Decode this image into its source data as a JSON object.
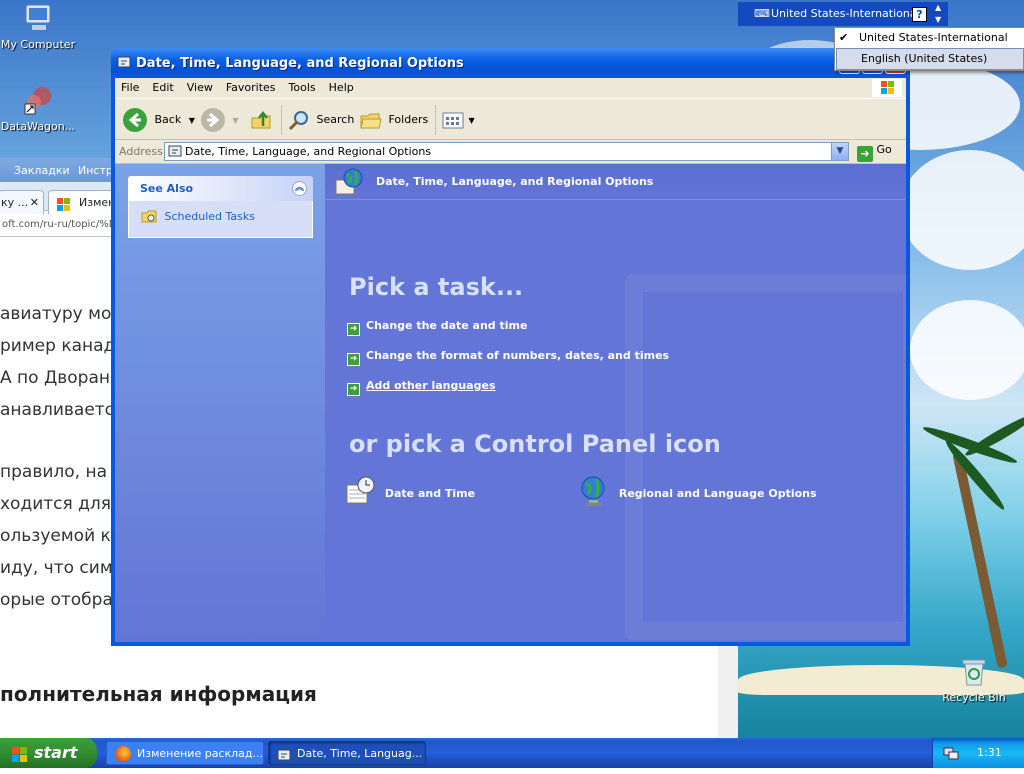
{
  "desktop": {
    "icons": [
      {
        "label": "My Computer"
      },
      {
        "label": "DataWagon..."
      },
      {
        "label": "Recycle Bin"
      }
    ]
  },
  "browser": {
    "menu_items": [
      "Закладки",
      "Инстр"
    ],
    "tab1": "ку ...",
    "tab2": "Измене",
    "url": "oft.com/ru-ru/topic/%D",
    "lines": [
      "авиатуру мож",
      "ример канад",
      "А по Дворан",
      "анавливаетс",
      "правило, на",
      "ходится для",
      "ользуемой к",
      "иду, что симв",
      "орые отобра"
    ],
    "heading": "полнительная информация"
  },
  "window": {
    "title": "Date, Time, Language, and Regional Options",
    "menu": [
      "File",
      "Edit",
      "View",
      "Favorites",
      "Tools",
      "Help"
    ],
    "toolbar": {
      "back": "Back",
      "search": "Search",
      "folders": "Folders"
    },
    "address": {
      "label": "Address",
      "value": "Date, Time, Language, and Regional Options",
      "go": "Go"
    },
    "see_also": {
      "title": "See Also",
      "items": [
        "Scheduled Tasks"
      ]
    },
    "header_title": "Date, Time, Language, and Regional Options",
    "pick_task": "Pick a task...",
    "tasks": [
      "Change the date and time",
      "Change the format of numbers, dates, and times",
      "Add other languages"
    ],
    "pick_icon": "or pick a Control Panel icon",
    "icons": [
      "Date and Time",
      "Regional and Language Options"
    ]
  },
  "language_bar": {
    "current": "United States-International",
    "menu": [
      "United States-International",
      "English (United States)"
    ]
  },
  "taskbar": {
    "start": "start",
    "tasks": [
      "Изменение расклад...",
      "Date, Time, Languag..."
    ],
    "clock": "1:31"
  }
}
